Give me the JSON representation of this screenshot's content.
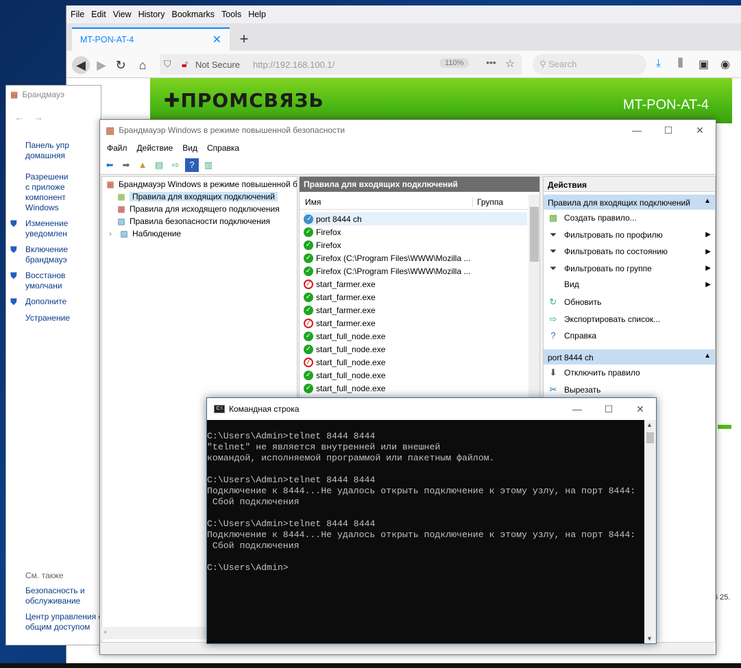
{
  "firefox": {
    "menu": [
      "File",
      "Edit",
      "View",
      "History",
      "Bookmarks",
      "Tools",
      "Help"
    ],
    "tab_title": "MT-PON-AT-4",
    "not_secure": "Not Secure",
    "url": "http://192.168.100.1/",
    "zoom": "110%",
    "search_placeholder": "Search",
    "page": {
      "logo": "ПРОМСВЯЗЬ",
      "device_title": "MT-PON-AT-4",
      "page_nums": "6   25."
    }
  },
  "control_panel": {
    "title": "Брандмауэ",
    "links": [
      "Панель упр\nдомашняя",
      "Разрешени\nс приложе\nкомпонент\nWindows",
      "Изменение\nуведомлен",
      "Включение\nбрандмауэ",
      "Восстанов\nумолчани",
      "Дополните",
      "Устранение"
    ],
    "see_also": "См. также",
    "footer_links": [
      "Безопасность и\nобслуживание",
      "Центр управления с\nобщим доступом"
    ]
  },
  "firewall": {
    "title": "Брандмауэр Windows в режиме повышенной безопасности",
    "menu": [
      "Файл",
      "Действие",
      "Вид",
      "Справка"
    ],
    "tree": {
      "root": "Брандмауэр Windows в режиме повышенной б",
      "items": [
        "Правила для входящих подключений",
        "Правила для исходящего подключения",
        "Правила безопасности подключения",
        "Наблюдение"
      ]
    },
    "center": {
      "header": "Правила для входящих подключений",
      "col_name": "Имя",
      "col_group": "Группа",
      "rules": [
        {
          "name": "port 8444 ch",
          "status": "selected"
        },
        {
          "name": "Firefox",
          "status": "allow"
        },
        {
          "name": "Firefox",
          "status": "allow"
        },
        {
          "name": "Firefox (C:\\Program Files\\WWW\\Mozilla ...",
          "status": "allow"
        },
        {
          "name": "Firefox (C:\\Program Files\\WWW\\Mozilla ...",
          "status": "allow"
        },
        {
          "name": "start_farmer.exe",
          "status": "block"
        },
        {
          "name": "start_farmer.exe",
          "status": "allow"
        },
        {
          "name": "start_farmer.exe",
          "status": "allow"
        },
        {
          "name": "start_farmer.exe",
          "status": "block"
        },
        {
          "name": "start_full_node.exe",
          "status": "allow"
        },
        {
          "name": "start_full_node.exe",
          "status": "allow"
        },
        {
          "name": "start_full_node.exe",
          "status": "block"
        },
        {
          "name": "start_full_node.exe",
          "status": "allow"
        },
        {
          "name": "start_full_node.exe",
          "status": "allow"
        }
      ]
    },
    "actions": {
      "header": "Действия",
      "section1": "Правила для входящих подключений",
      "items1": [
        {
          "label": "Создать правило...",
          "icon": "new-rule-icon",
          "sub": false
        },
        {
          "label": "Фильтровать по профилю",
          "icon": "filter-icon",
          "sub": true
        },
        {
          "label": "Фильтровать по состоянию",
          "icon": "filter-icon",
          "sub": true
        },
        {
          "label": "Фильтровать по группе",
          "icon": "filter-icon",
          "sub": true
        },
        {
          "label": "Вид",
          "icon": "",
          "sub": true
        },
        {
          "label": "Обновить",
          "icon": "refresh-icon",
          "sub": false
        },
        {
          "label": "Экспортировать список...",
          "icon": "export-icon",
          "sub": false
        },
        {
          "label": "Справка",
          "icon": "help-icon",
          "sub": false
        }
      ],
      "section2": "port 8444 ch",
      "items2": [
        {
          "label": "Отключить правило",
          "icon": "disable-icon"
        },
        {
          "label": "Вырезать",
          "icon": "cut-icon"
        }
      ]
    }
  },
  "cmd": {
    "title": "Командная строка",
    "lines": [
      "C:\\Users\\Admin>telnet 8444 8444",
      "\"telnet\" не является внутренней или внешней",
      "командой, исполняемой программой или пакетным файлом.",
      "",
      "C:\\Users\\Admin>telnet 8444 8444",
      "Подключение к 8444...Не удалось открыть подключение к этому узлу, на порт 8444:",
      " Сбой подключения",
      "",
      "C:\\Users\\Admin>telnet 8444 8444",
      "Подключение к 8444...Не удалось открыть подключение к этому узлу, на порт 8444:",
      " Сбой подключения",
      "",
      "C:\\Users\\Admin>"
    ]
  }
}
